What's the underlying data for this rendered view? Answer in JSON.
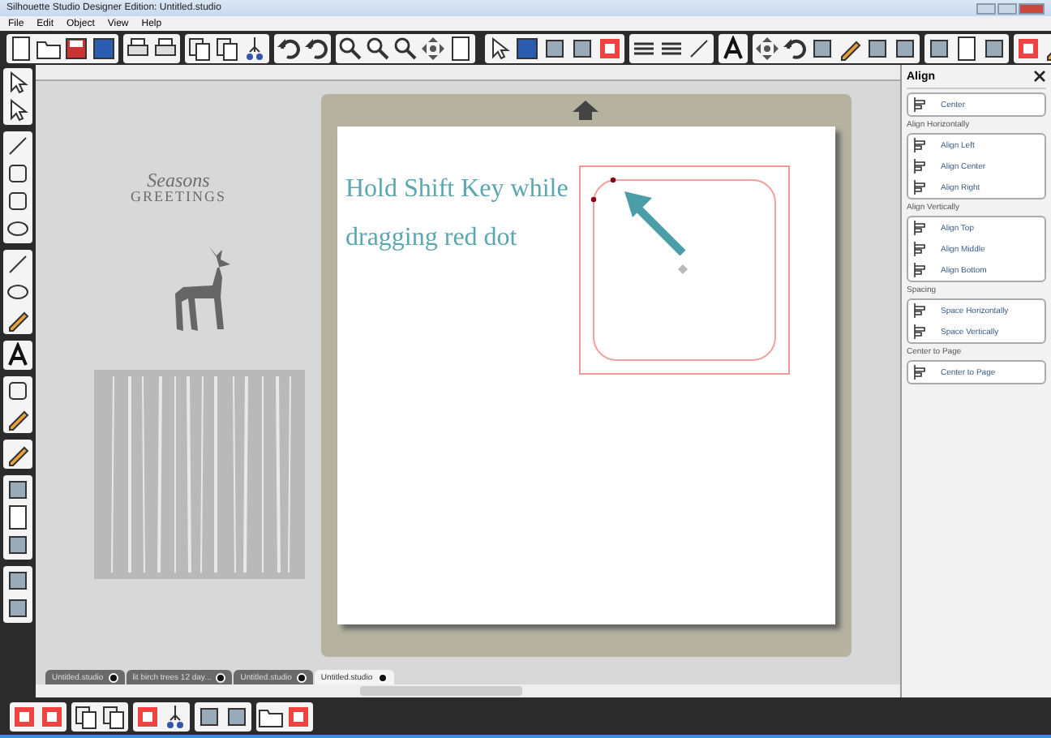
{
  "window": {
    "title": "Silhouette Studio Designer Edition: Untitled.studio"
  },
  "menu": [
    "File",
    "Edit",
    "Object",
    "View",
    "Help"
  ],
  "canvas": {
    "greeting_lines": [
      "Seasons",
      "GREETINGS"
    ],
    "instruction_lines": [
      "Hold Shift Key while",
      "dragging red dot"
    ]
  },
  "align_panel": {
    "title": "Align",
    "sections": [
      {
        "buttons": [
          "Center"
        ]
      },
      {
        "heading": "Align Horizontally",
        "buttons": [
          "Align Left",
          "Align Center",
          "Align Right"
        ]
      },
      {
        "heading": "Align Vertically",
        "buttons": [
          "Align Top",
          "Align Middle",
          "Align Bottom"
        ]
      },
      {
        "heading": "Spacing",
        "buttons": [
          "Space Horizontally",
          "Space Vertically"
        ]
      },
      {
        "heading": "Center to Page",
        "buttons": [
          "Center to Page"
        ]
      }
    ]
  },
  "document_tabs": [
    {
      "label": "Untitled.studio",
      "selected": false
    },
    {
      "label": "lit birch trees 12 day...",
      "selected": false
    },
    {
      "label": "Untitled.studio",
      "selected": false
    },
    {
      "label": "Untitled.studio",
      "selected": true
    }
  ]
}
